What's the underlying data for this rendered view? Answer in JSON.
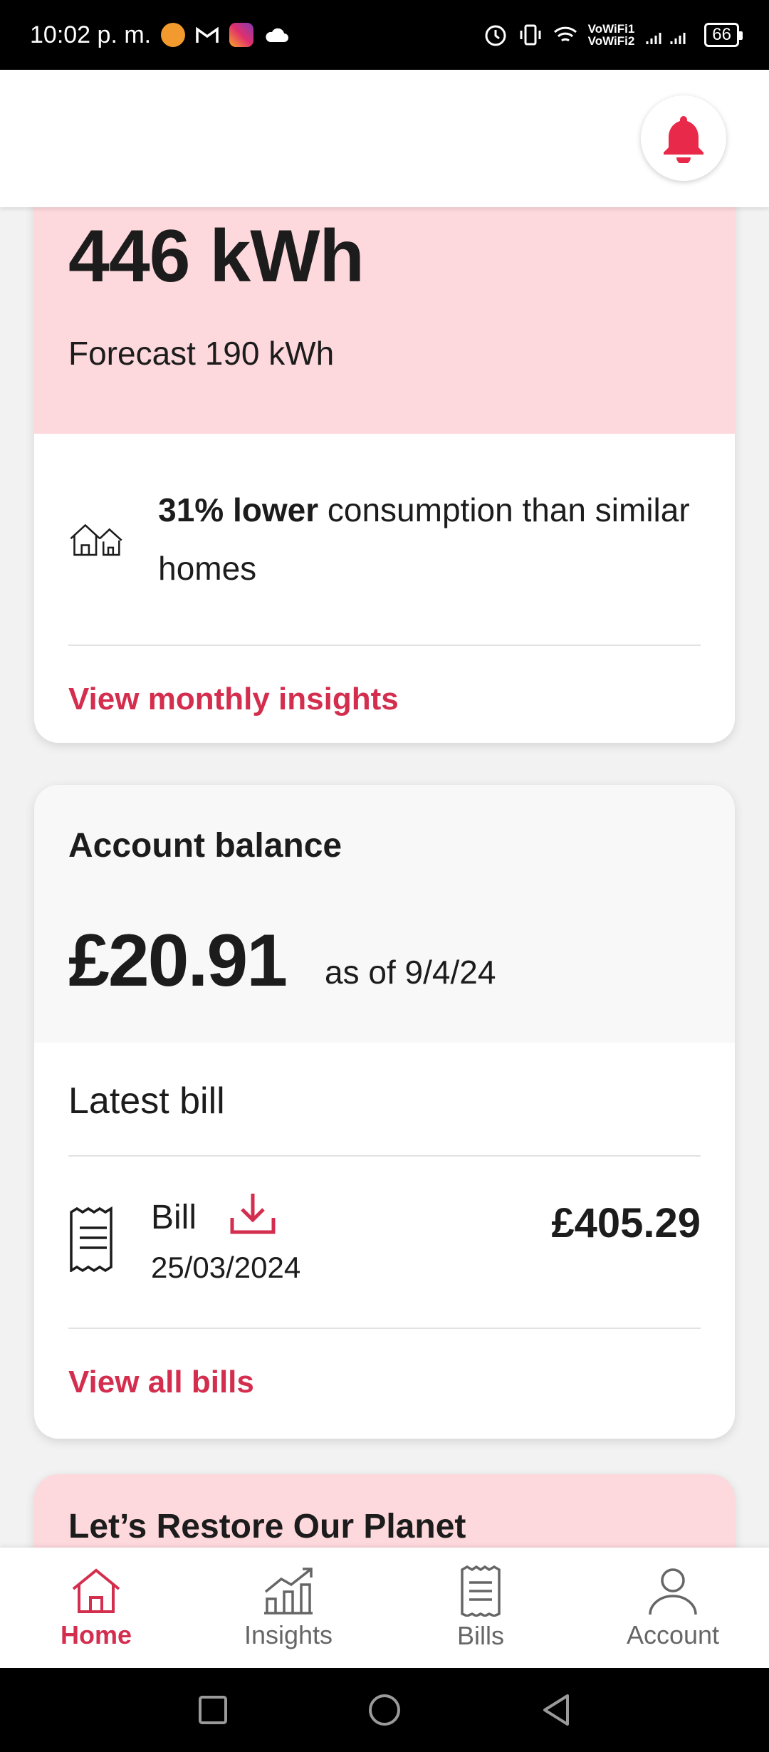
{
  "status_bar": {
    "time": "10:02 p. m.",
    "vowifi_1": "VoWiFi1",
    "vowifi_2": "VoWiFi2",
    "battery": "66"
  },
  "usage": {
    "value": "446 kWh",
    "forecast": "Forecast 190 kWh",
    "comparison_bold": "31% lower",
    "comparison_rest": " consumption than similar homes",
    "link": "View monthly insights"
  },
  "balance": {
    "title": "Account balance",
    "amount": "£20.91",
    "as_of": "as of 9/4/24",
    "latest_bill_label": "Latest bill",
    "bill_label": "Bill",
    "bill_date": "25/03/2024",
    "bill_amount": "£405.29",
    "link": "View all bills"
  },
  "planet": {
    "title": "Let’s Restore Our Planet"
  },
  "nav": [
    {
      "label": "Home",
      "icon": "home-icon",
      "active": true
    },
    {
      "label": "Insights",
      "icon": "insights-icon",
      "active": false
    },
    {
      "label": "Bills",
      "icon": "bills-icon",
      "active": false
    },
    {
      "label": "Account",
      "icon": "account-icon",
      "active": false
    }
  ],
  "colors": {
    "accent": "#d42e4f",
    "pink_bg": "#fdd8dc",
    "bell": "#e8294a"
  }
}
